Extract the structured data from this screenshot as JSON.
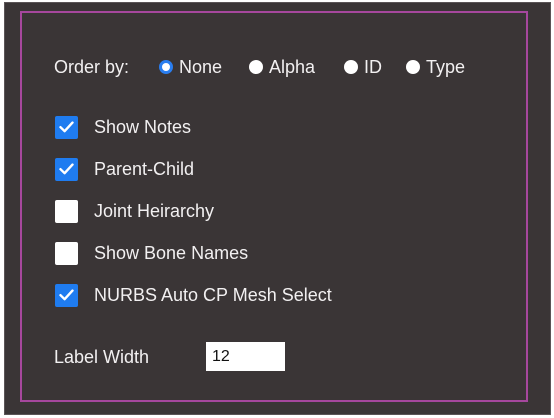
{
  "order_by": {
    "label": "Order by:",
    "options": [
      {
        "label": "None",
        "selected": true
      },
      {
        "label": "Alpha",
        "selected": false
      },
      {
        "label": "ID",
        "selected": false
      },
      {
        "label": "Type",
        "selected": false
      }
    ]
  },
  "options": [
    {
      "label": "Show Notes",
      "checked": true
    },
    {
      "label": "Parent-Child",
      "checked": true
    },
    {
      "label": "Joint Heirarchy",
      "checked": false
    },
    {
      "label": "Show Bone Names",
      "checked": false
    },
    {
      "label": "NURBS Auto CP Mesh Select",
      "checked": true
    }
  ],
  "label_width": {
    "label": "Label Width",
    "value": "12"
  },
  "colors": {
    "background": "#3a3536",
    "panel_border": "#a6479d",
    "accent": "#1f7cf0",
    "text": "#f2f0f1"
  }
}
